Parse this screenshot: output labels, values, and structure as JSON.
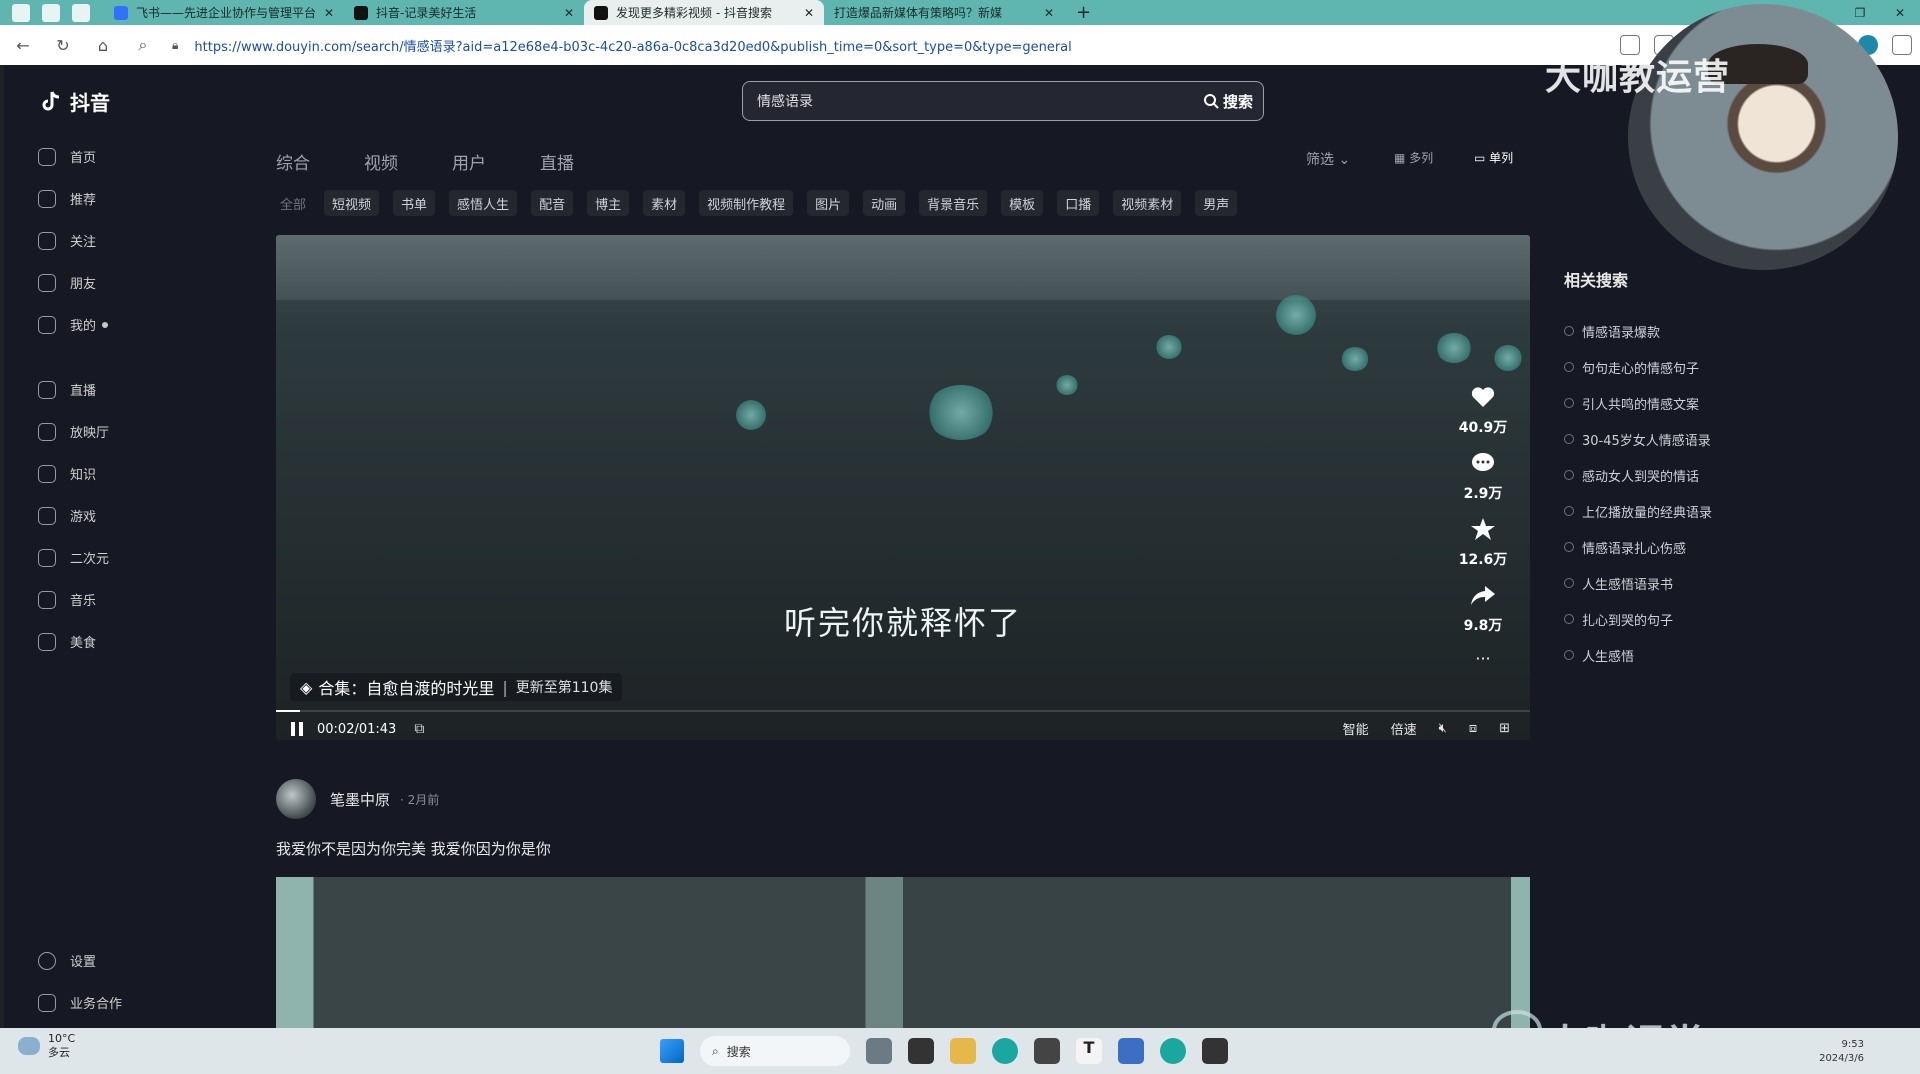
{
  "browser": {
    "tabs": [
      {
        "title": "飞书——先进企业协作与管理平台",
        "active": false
      },
      {
        "title": "抖音-记录美好生活",
        "active": false
      },
      {
        "title": "发现更多精彩视频 - 抖音搜索",
        "active": true
      },
      {
        "title": "打造爆品新媒体有策略吗？新媒",
        "active": false
      }
    ],
    "new_tab": "+",
    "url": "https://www.douyin.com/search/情感语录?aid=a12e68e4-b03c-4c20-a86a-0c8ca3d20ed0&publish_time=0&sort_type=0&type=general"
  },
  "app": {
    "logo": "抖音",
    "sidebar": [
      {
        "label": "首页",
        "icon": "home-icon"
      },
      {
        "label": "推荐",
        "icon": "sparkle-icon"
      },
      {
        "label": "关注",
        "icon": "follow-icon"
      },
      {
        "label": "朋友",
        "icon": "friends-icon"
      },
      {
        "label": "我的",
        "icon": "user-icon"
      },
      {
        "label": "直播",
        "icon": "live-icon"
      },
      {
        "label": "放映厅",
        "icon": "cinema-icon"
      },
      {
        "label": "知识",
        "icon": "knowledge-icon"
      },
      {
        "label": "游戏",
        "icon": "game-icon"
      },
      {
        "label": "二次元",
        "icon": "anime-icon"
      },
      {
        "label": "音乐",
        "icon": "music-icon"
      },
      {
        "label": "美食",
        "icon": "food-icon"
      }
    ],
    "sidebar_bottom": [
      {
        "label": "设置",
        "icon": "settings-icon"
      },
      {
        "label": "业务合作",
        "icon": "business-icon"
      }
    ],
    "search": {
      "value": "情感语录",
      "button": "搜索"
    },
    "tabs": [
      "综合",
      "视频",
      "用户",
      "直播"
    ],
    "filter_label": "筛选",
    "view_multi": "多列",
    "view_single": "单列",
    "chips": [
      "全部",
      "短视频",
      "书单",
      "感悟人生",
      "配音",
      "博主",
      "素材",
      "视频制作教程",
      "图片",
      "动画",
      "背景音乐",
      "模板",
      "口播",
      "视频素材",
      "男声"
    ],
    "video": {
      "subtitle": "听完你就释怀了",
      "collection": "合集：自愈自渡的时光里",
      "collection_update": "更新至第110集",
      "likes": "40.9万",
      "comments": "2.9万",
      "favorites": "12.6万",
      "shares": "9.8万",
      "more": "···",
      "time": "00:02/01:43",
      "progress": 0.019,
      "smart": "智能",
      "speed": "倍速"
    },
    "author": {
      "name": "笔墨中原",
      "time": "2月前"
    },
    "description": "我爱你不是因为你完美 我爱你因为你是你",
    "related": {
      "title": "相关搜索",
      "items": [
        "情感语录爆款",
        "句句走心的情感句子",
        "引人共鸣的情感文案",
        "30-45岁女人情感语录",
        "感动女人到哭的情话",
        "上亿播放量的经典语录",
        "情感语录扎心伤感",
        "人生感悟语录书",
        "扎心到哭的句子",
        "人生感悟"
      ]
    }
  },
  "overlay": {
    "watermark_top": "大咖教运营",
    "watermark_bottom": "大咖课堂"
  },
  "taskbar": {
    "temp": "10°C",
    "weather": "多云",
    "search": "搜索",
    "time": "9:53",
    "date": "2024/3/6"
  }
}
